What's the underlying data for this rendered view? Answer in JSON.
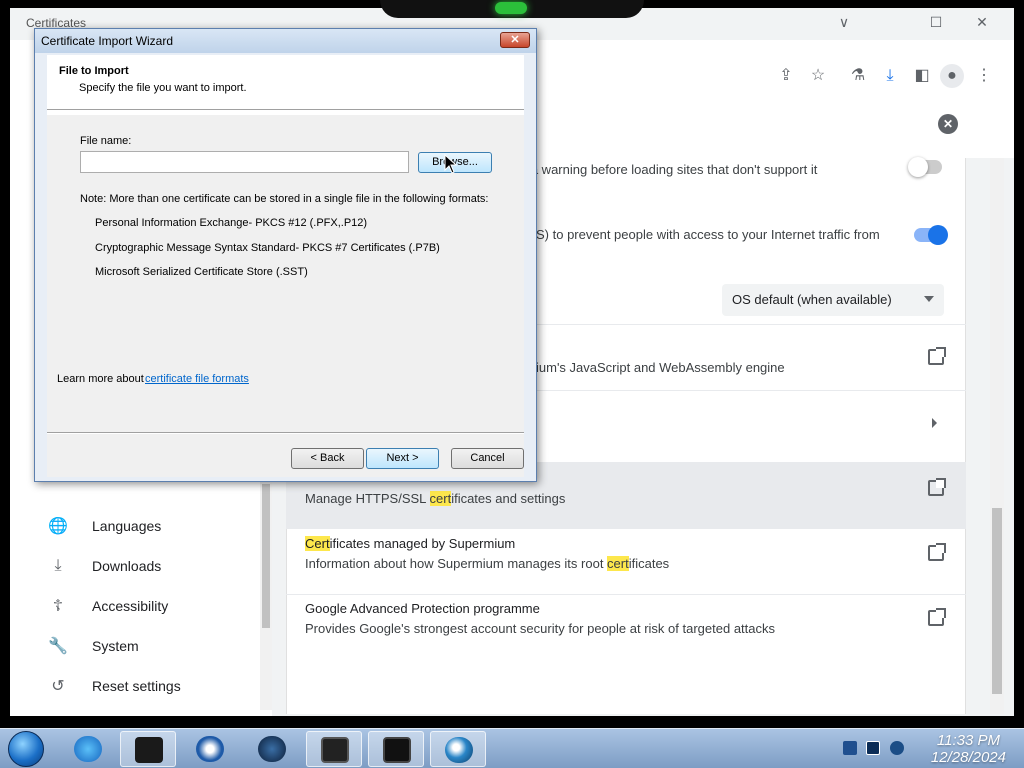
{
  "back_window": {
    "title": "Certificates",
    "min": "∨",
    "restore": "☐",
    "close": "✕"
  },
  "search_clear": "✕",
  "toolbar_icons": {
    "share": "⇪",
    "bookmark": "☆",
    "labs": "⚗",
    "download": "⤓",
    "sidepanel": "◧",
    "profile": "●",
    "menu": "⋮"
  },
  "sidebar": {
    "items": [
      {
        "label": "Languages",
        "icon": "globe-icon"
      },
      {
        "label": "Downloads",
        "icon": "download-icon"
      },
      {
        "label": "Accessibility",
        "icon": "accessibility-icon"
      },
      {
        "label": "System",
        "icon": "wrench-icon"
      },
      {
        "label": "Reset settings",
        "icon": "history-icon"
      }
    ]
  },
  "settings": {
    "row1_text": "e a warning before loading sites that don't support it",
    "row2_text": "S) to prevent people with access to your Internet traffic from",
    "dns_select": "OS default (when available)",
    "row3_text": "ium's JavaScript and WebAssembly engine",
    "manage_certs_desc_a": "Manage HTTPS/SSL ",
    "manage_certs_desc_hl": "cert",
    "manage_certs_desc_b": "ificates and settings",
    "certs_managed_title_hl": "Cert",
    "certs_managed_title_b": "ificates managed by Supermium",
    "certs_managed_desc_a": "Information about how Supermium manages its root ",
    "certs_managed_desc_hl": "cert",
    "certs_managed_desc_b": "ificates",
    "gap_title": "Google Advanced Protection programme",
    "gap_desc": "Provides Google's strongest account security for people at risk of targeted attacks"
  },
  "dialog": {
    "title": "Certificate Import Wizard",
    "close_glyph": "✕",
    "section_title": "File to Import",
    "subtitle": "Specify the file you want to import.",
    "file_label": "File name:",
    "file_value": "",
    "browse": "Browse...",
    "note": "Note:  More than one certificate can be stored in a single file in the following formats:",
    "formats": [
      "Personal Information Exchange- PKCS #12 (.PFX,.P12)",
      "Cryptographic Message Syntax Standard- PKCS #7 Certificates (.P7B)",
      "Microsoft Serialized Certificate Store (.SST)"
    ],
    "learn_more": "Learn more about ",
    "learn_link": "certificate file formats",
    "back": "< Back",
    "next": "Next >",
    "cancel": "Cancel"
  },
  "taskbar": {
    "time": "11:33 PM",
    "date": "12/28/2024"
  },
  "colors": {
    "highlight": "#fde74c",
    "toggle_on": "#1a73e8",
    "link": "#0066cc"
  }
}
